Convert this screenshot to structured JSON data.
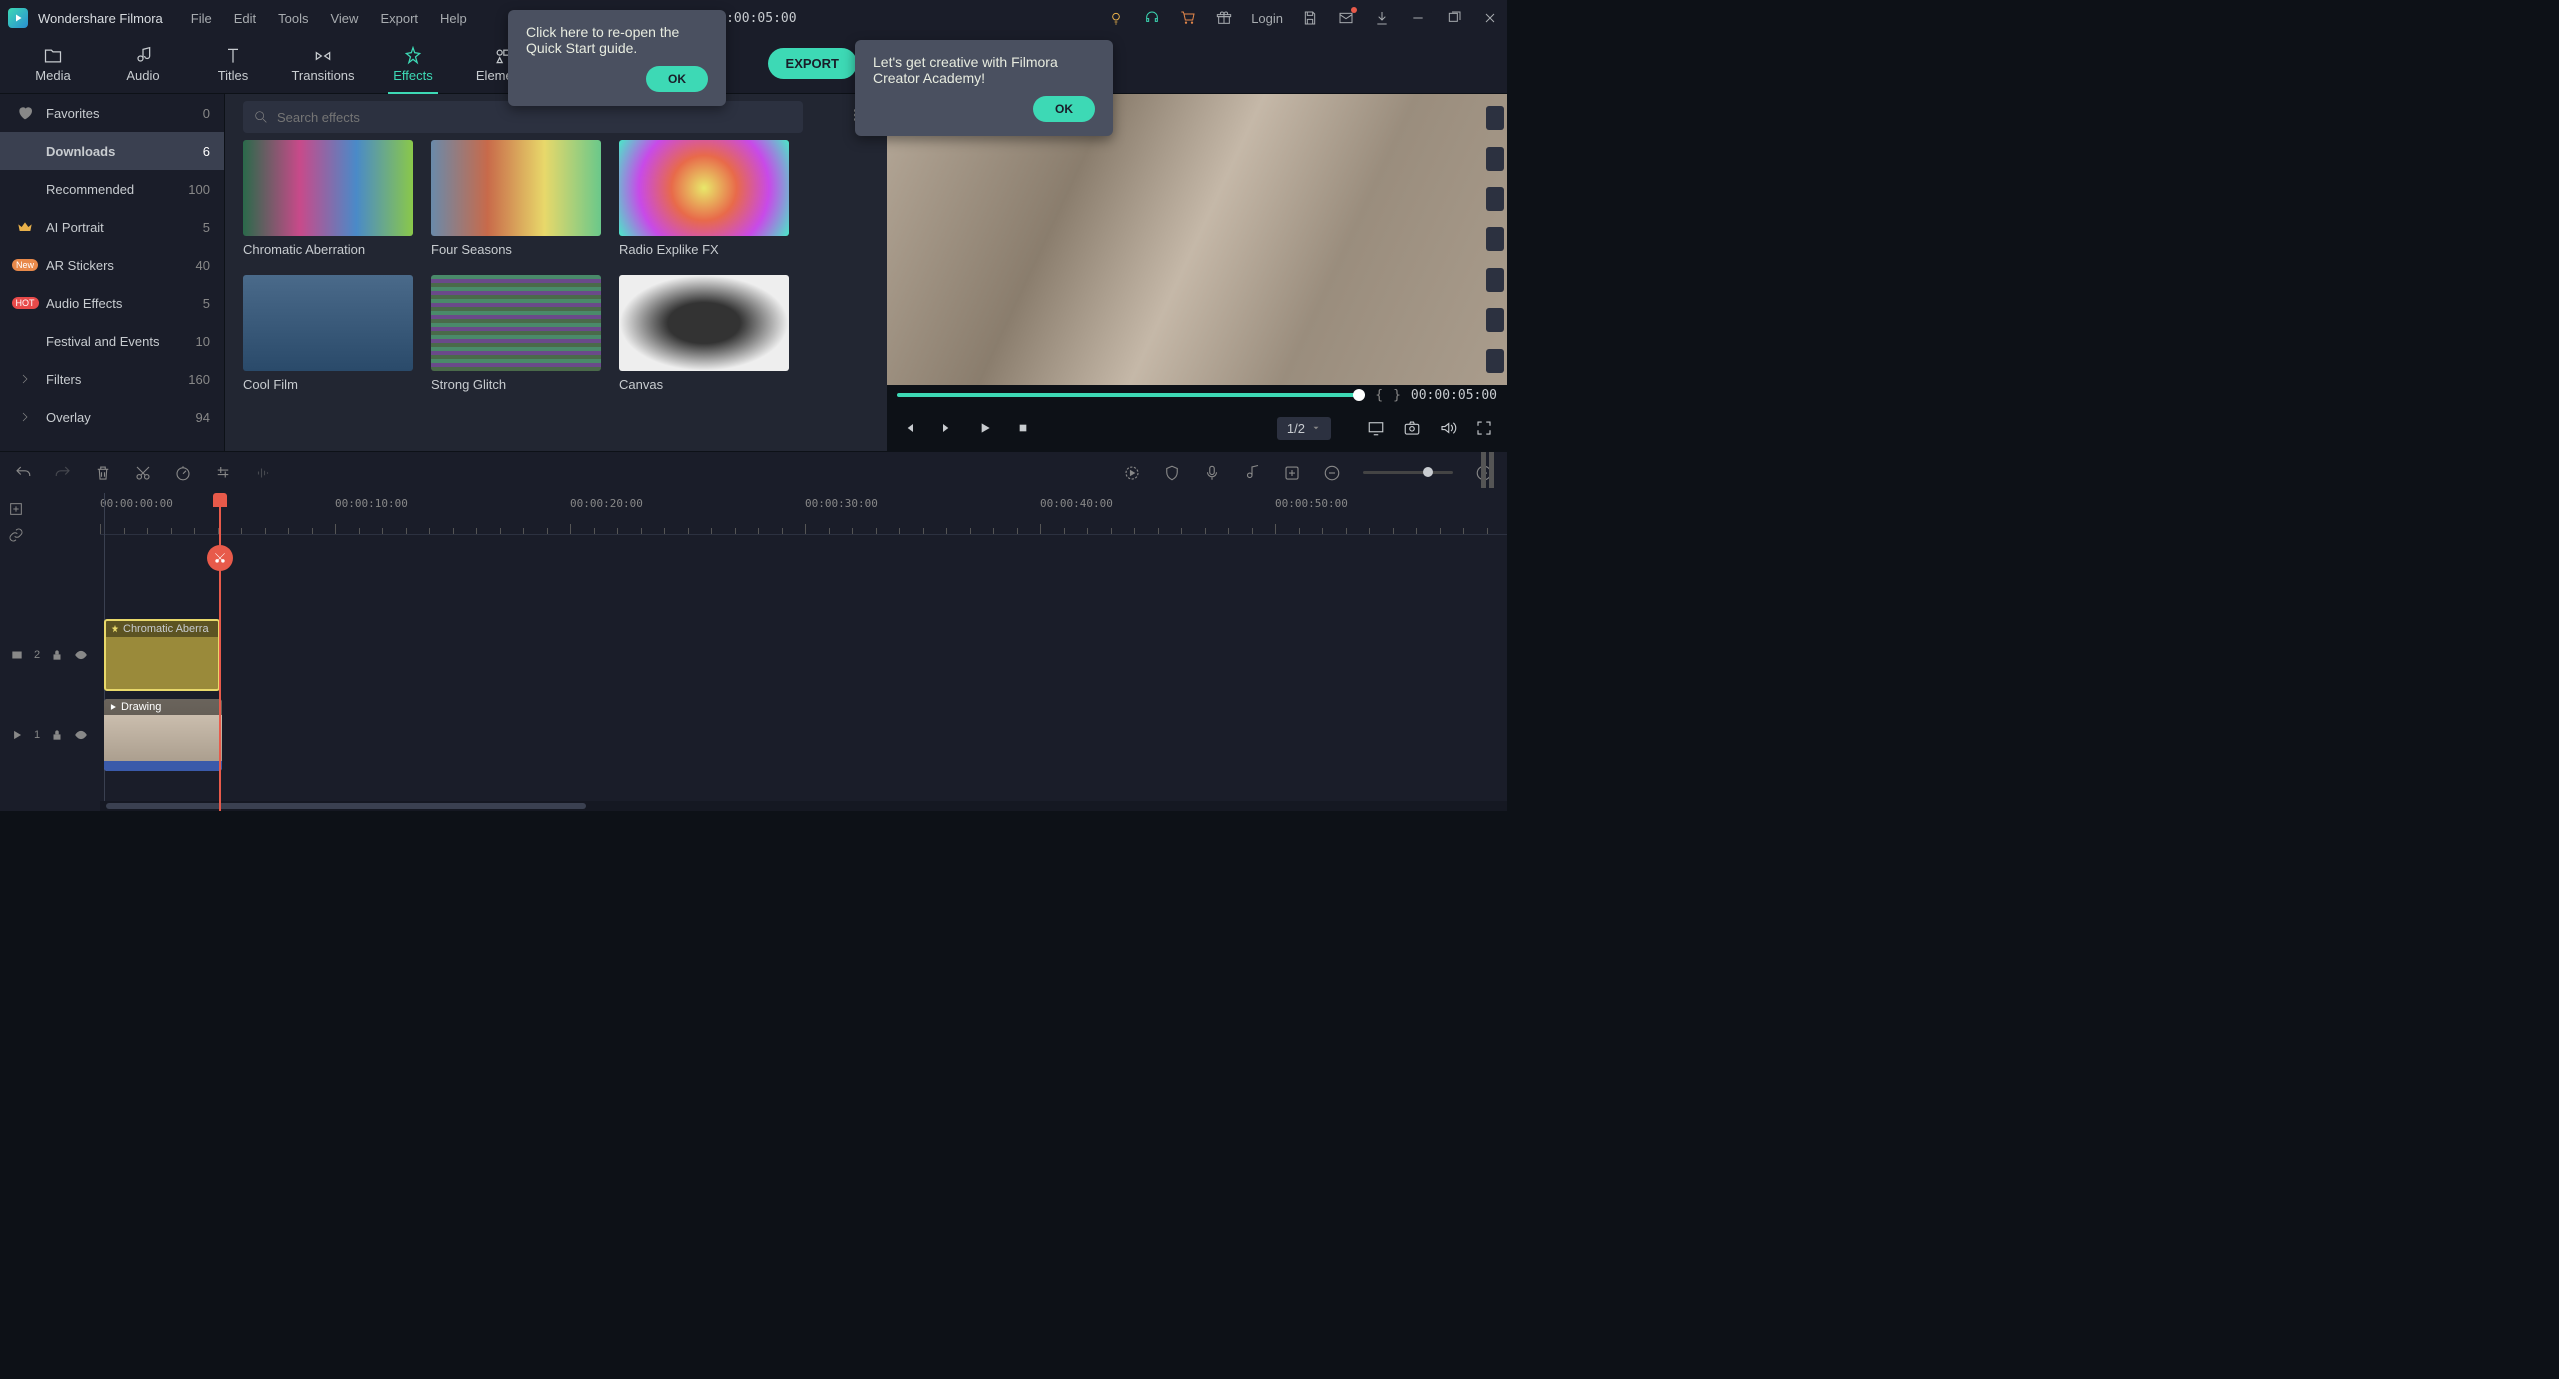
{
  "app_title": "Wondershare Filmora",
  "menu": [
    "File",
    "Edit",
    "Tools",
    "View",
    "Export",
    "Help"
  ],
  "center_time": "00:00:05:00",
  "login": "Login",
  "tabs": [
    {
      "label": "Media"
    },
    {
      "label": "Audio"
    },
    {
      "label": "Titles"
    },
    {
      "label": "Transitions"
    },
    {
      "label": "Effects",
      "active": true
    },
    {
      "label": "Elements"
    }
  ],
  "sidebar": [
    {
      "icon": "heart",
      "label": "Favorites",
      "count": "0"
    },
    {
      "icon": "",
      "label": "Downloads",
      "count": "6",
      "selected": true
    },
    {
      "icon": "",
      "label": "Recommended",
      "count": "100"
    },
    {
      "icon": "crown",
      "label": "AI Portrait",
      "count": "5"
    },
    {
      "icon": "new",
      "label": "AR Stickers",
      "count": "40"
    },
    {
      "icon": "hot",
      "label": "Audio Effects",
      "count": "5"
    },
    {
      "icon": "",
      "label": "Festival and Events",
      "count": "10"
    },
    {
      "icon": "caret",
      "label": "Filters",
      "count": "160"
    },
    {
      "icon": "caret",
      "label": "Overlay",
      "count": "94"
    }
  ],
  "search_placeholder": "Search effects",
  "effects": [
    {
      "label": "Chromatic Aberration",
      "bg": "linear-gradient(90deg,#2a6a4a,#c84a8a,#4a8ac8,#8ac84a)"
    },
    {
      "label": "Four Seasons",
      "bg": "linear-gradient(90deg,#6a8aaa,#c86a4a,#e8d86a,#6ac88a)"
    },
    {
      "label": "Radio Explike FX",
      "bg": "radial-gradient(circle,#e8e86a,#e86a4a,#c84ae8,#4ae8c8)"
    },
    {
      "label": "Cool Film",
      "bg": "linear-gradient(#4a6a8a,#2a4a6a)"
    },
    {
      "label": "Strong Glitch",
      "bg": "repeating-linear-gradient(0deg,#4a6a4a 0 4px,#6a4a8a 4px 8px,#4a8a6a 8px 12px)"
    },
    {
      "label": "Canvas",
      "bg": "radial-gradient(ellipse,#333 30%,#eee 70%)"
    }
  ],
  "export": "EXPORT",
  "tooltip1": {
    "text": "Click here to re-open the Quick Start guide.",
    "ok": "OK"
  },
  "tooltip2": {
    "text": "Let's get creative with Filmora Creator Academy!",
    "ok": "OK"
  },
  "preview": {
    "braces_l": "{",
    "braces_r": "}",
    "time": "00:00:05:00",
    "ratio": "1/2"
  },
  "ruler": [
    "00:00:00:00",
    "00:00:10:00",
    "00:00:20:00",
    "00:00:30:00",
    "00:00:40:00",
    "00:00:50:00"
  ],
  "tracks": {
    "fx": {
      "num": "2",
      "clip": "Chromatic Aberra"
    },
    "vid": {
      "num": "1",
      "clip": "Drawing"
    }
  },
  "badges": {
    "new": "New",
    "hot": "HOT"
  }
}
